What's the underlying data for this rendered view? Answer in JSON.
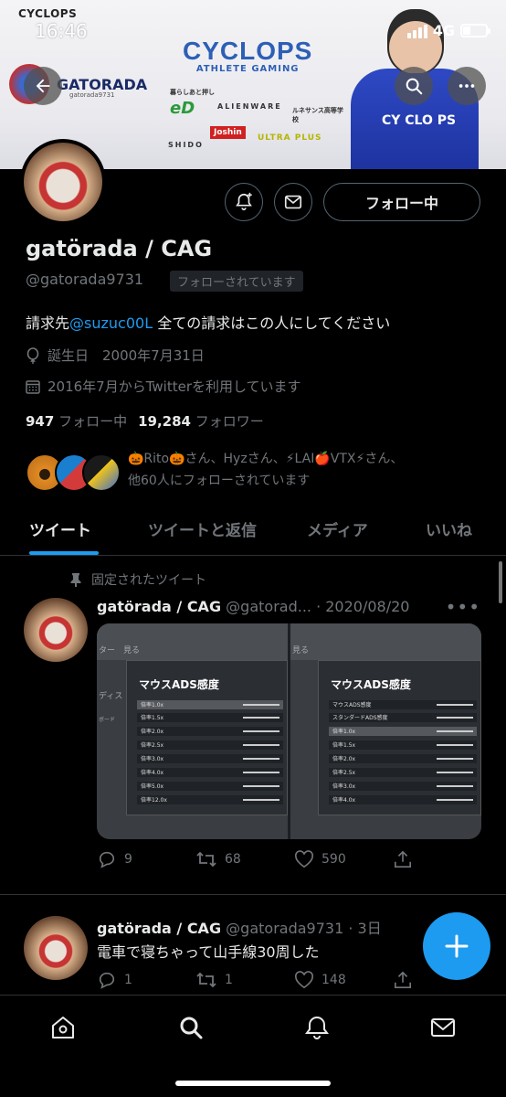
{
  "status_bar": {
    "time": "16:46",
    "network": "4G",
    "banner_corner_logo": "CYCLOPS"
  },
  "banner": {
    "brand": "CYCLOPS",
    "brand_sub": "ATHLETE GAMING",
    "name": "GATORADA",
    "handle": "gatorada9731",
    "sponsors": [
      "暮らしあと押し",
      "ALIENWARE",
      "ルネサンス高等学校",
      "SHIDO",
      "Joshin",
      "ULTRA PLUS"
    ],
    "jersey": "CY CLO PS"
  },
  "profile": {
    "follow_button": "フォロー中",
    "name": "gatörada / CAG",
    "handle": "@gatorada9731",
    "follows_you": "フォローされています",
    "bio_prefix": "請求先",
    "bio_mention": "@suzuc00L",
    "bio_suffix": " 全ての請求はこの人にしてください",
    "birthday": "誕生日　2000年7月31日",
    "joined": "2016年7月からTwitterを利用しています",
    "following_count": "947",
    "following_label": "フォロー中",
    "followers_count": "19,284",
    "followers_label": "フォロワー",
    "followed_by_line1": "🎃Rito🎃さん、Hyzさん、⚡LAI🍎VTX⚡さん、",
    "followed_by_line2": "他60人にフォローされています"
  },
  "tabs": [
    {
      "label": "ツイート",
      "active": true
    },
    {
      "label": "ツイートと返信",
      "active": false
    },
    {
      "label": "メディア",
      "active": false
    },
    {
      "label": "いいね",
      "active": false
    }
  ],
  "tweets": [
    {
      "pinned_label": "固定されたツイート",
      "name": "gatörada / CAG",
      "handle_date": "@gatorad... · 2020/08/20",
      "replies": "9",
      "retweets": "68",
      "likes": "590",
      "media": {
        "top_labels": [
          "ター　見る",
          "見る"
        ],
        "panel_title": "マウスADS感度",
        "side_labels_left": [
          "ディス",
          "ボード"
        ],
        "rows_left": [
          "倍率1.0x",
          "倍率1.5x",
          "倍率2.0x",
          "倍率2.5x",
          "倍率3.0x",
          "倍率4.0x",
          "倍率5.0x",
          "倍率12.0x"
        ],
        "rows_right": [
          "マウスADS感度",
          "スタンダードADS感度",
          "倍率1.0x",
          "倍率1.5x",
          "倍率2.0x",
          "倍率2.5x",
          "倍率3.0x",
          "倍率4.0x"
        ]
      }
    },
    {
      "name": "gatörada / CAG",
      "handle_date": "@gatorada9731 · 3日",
      "text": "電車で寝ちゃって山手線30周した",
      "replies": "1",
      "retweets": "1",
      "likes": "148"
    }
  ],
  "colors": {
    "accent": "#1d9bf0",
    "muted": "#71767b",
    "text": "#e7e9ea",
    "border": "#2f3336"
  }
}
